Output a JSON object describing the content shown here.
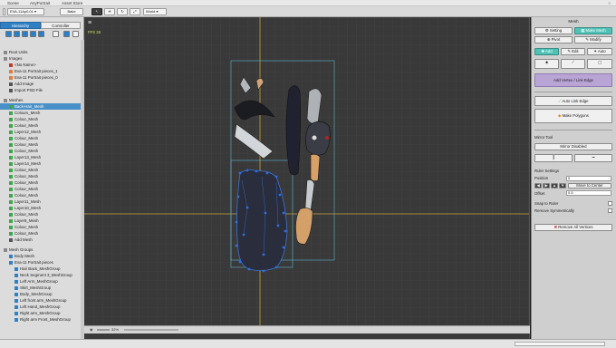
{
  "menubar": {
    "tabs": [
      "Scene",
      "AnyPortrait",
      "Asset Store"
    ]
  },
  "toolbar": {
    "file_label": "EVA-11Ap0.01",
    "bake_label": "Bake",
    "view_label": "World"
  },
  "left": {
    "tabs": [
      "Hierarchy",
      "Controller"
    ],
    "root_units": "Root Units",
    "images_header": "Images",
    "images": [
      "<No Name>",
      "Eva-11 Portrait pieces_1",
      "Eva-11 Portrait pieces_0"
    ],
    "add_image": "Add Image",
    "import_psd": "Import PSD File",
    "meshes_header": "Meshes",
    "meshes": [
      "Back-Hair_Mesh",
      "Colours_Mesh",
      "Colour_Mesh",
      "Colour_Mesh",
      "Layer12_Mesh",
      "Colour_Mesh",
      "Colour_Mesh",
      "Colour_Mesh",
      "Layer13_Mesh",
      "Layer14_Mesh",
      "Colour_Mesh",
      "Colour_Mesh",
      "Colour_Mesh",
      "Colour_Mesh",
      "Colour_Mesh",
      "Layer11_Mesh",
      "Layer10_Mesh",
      "Colour_Mesh",
      "Layer8_Mesh",
      "Colour_Mesh",
      "Colour_Mesh"
    ],
    "add_mesh": "Add Mesh",
    "mesh_groups_header": "Mesh Groups",
    "mesh_groups": [
      "Body Mesh",
      "Eva-11 Portrait pieces"
    ],
    "mesh_group_children": [
      "Hair Back_MeshGroup",
      "Neck Segment 3_MeshGroup",
      "Left Arm_MeshGroup",
      "Skirt_MeshGroup",
      "Body_MeshGroup",
      "Left front arm_MeshGroup",
      "Left Hand_MeshGroup",
      "Right arm_MeshGroup",
      "Right arm Front_MeshGroup"
    ]
  },
  "viewport": {
    "fps": "FPS 38",
    "zoom": "32%"
  },
  "right": {
    "header": "Mesh",
    "setting": "Setting",
    "make_mesh": "Make Mesh",
    "pivot": "Pivot",
    "modify": "Modify",
    "add": "Add",
    "edit": "Edit",
    "auto": "Auto",
    "add_vertex": "Add Vertex / Link Edge",
    "auto_link": "Auto Link Edge",
    "make_polygons": "Make Polygons",
    "mirror_tool": "Mirror Tool",
    "mirror_disabled": "Mirror Disabled",
    "ruler_settings": "Ruler Settings",
    "position_label": "Position",
    "position_value": "0",
    "move_to_center": "Move to Center",
    "offset_label": "Offset",
    "offset_value": "0.5",
    "snap_to_ruler": "Snap to Ruler",
    "remove_symmetrically": "Remove Symmetrically",
    "remove_all_vertices": "Remove All Vertices"
  },
  "colors": {
    "accent": "#4ec2b6",
    "selection": "#4a90c8",
    "mesh_line": "#2f6fe0",
    "guide": "#c8a63a"
  }
}
